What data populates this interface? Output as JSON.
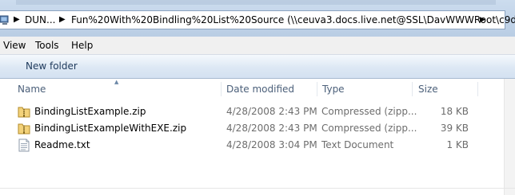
{
  "address_bar": {
    "segments": [
      "DUN...",
      "Fun%20With%20Bindling%20List%20Source (\\\\ceuva3.docs.live.net@SSL\\DavWWWRoot\\c9d0..."
    ]
  },
  "menu": {
    "items": [
      "View",
      "Tools",
      "Help"
    ]
  },
  "toolbar": {
    "new_folder_label": "New folder"
  },
  "columns": {
    "name": "Name",
    "date_modified": "Date modified",
    "type": "Type",
    "size": "Size"
  },
  "files": [
    {
      "name": "BindingListExample.zip",
      "date": "4/28/2008 2:43 PM",
      "type": "Compressed (zipp...",
      "size": "18 KB",
      "icon": "zip-folder-icon"
    },
    {
      "name": "BindingListExampleWithEXE.zip",
      "date": "4/28/2008 2:43 PM",
      "type": "Compressed (zipp...",
      "size": "39 KB",
      "icon": "zip-folder-icon"
    },
    {
      "name": "Readme.txt",
      "date": "4/28/2008 3:04 PM",
      "type": "Text Document",
      "size": "1 KB",
      "icon": "text-file-icon"
    }
  ]
}
